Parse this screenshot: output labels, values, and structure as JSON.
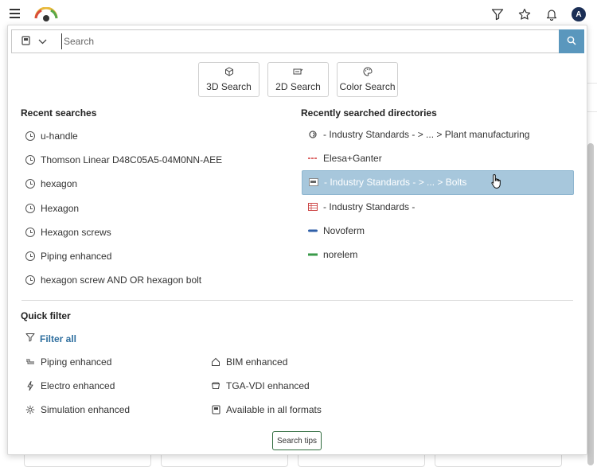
{
  "header": {
    "icons": [
      "hamburger-menu-icon",
      "gauge-logo-icon",
      "filter-icon",
      "star-icon",
      "bell-icon",
      "avatar"
    ],
    "avatar_initial": "A"
  },
  "search": {
    "placeholder": "Search",
    "catalog_icon": "catalog-book-icon",
    "submit_icon": "search-icon"
  },
  "modes": [
    {
      "label": "3D Search",
      "icon": "cube-icon"
    },
    {
      "label": "2D Search",
      "icon": "sketch-icon"
    },
    {
      "label": "Color Search",
      "icon": "palette-icon"
    }
  ],
  "recent": {
    "title": "Recent searches",
    "items": [
      "u-handle",
      "Thomson Linear D48C05A5-04M0NN-AEE",
      "hexagon",
      "Hexagon",
      "Hexagon screws",
      "Piping enhanced",
      "hexagon screw AND OR hexagon bolt"
    ]
  },
  "directories": {
    "title": "Recently searched directories",
    "items": [
      {
        "label": "- Industry Standards - > ... > Plant manufacturing",
        "active": false
      },
      {
        "label": "Elesa+Ganter",
        "active": false
      },
      {
        "label": "- Industry Standards - > ... > Bolts",
        "active": true
      },
      {
        "label": "- Industry Standards -",
        "active": false
      },
      {
        "label": "Novoferm",
        "active": false
      },
      {
        "label": "norelem",
        "active": false
      }
    ]
  },
  "quick_filter": {
    "title": "Quick filter",
    "filter_all": "Filter all",
    "items": [
      {
        "label": "Piping enhanced",
        "icon": "piping-icon"
      },
      {
        "label": "BIM enhanced",
        "icon": "house-icon"
      },
      {
        "label": "Electro enhanced",
        "icon": "lightning-icon"
      },
      {
        "label": "TGA-VDI enhanced",
        "icon": "duct-icon"
      },
      {
        "label": "Simulation enhanced",
        "icon": "gear-icon"
      },
      {
        "label": "Available in all formats",
        "icon": "formats-icon"
      }
    ]
  },
  "tips_button": "Search tips",
  "colors": {
    "accent": "#5a97bd",
    "active_row": "#a7c7dc",
    "link": "#2f6f9f",
    "tips_border": "#2f6b3d"
  }
}
